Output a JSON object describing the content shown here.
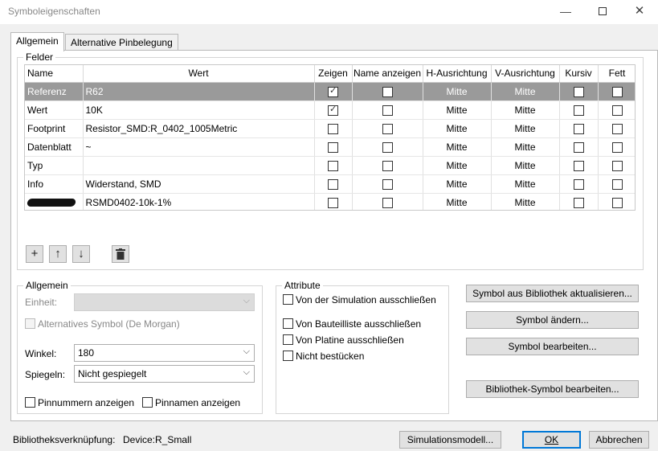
{
  "window": {
    "title": "Symboleigenschaften",
    "minimize_icon": "—",
    "close_icon": "✕"
  },
  "tabs": [
    {
      "label": "Allgemein"
    },
    {
      "label": "Alternative Pinbelegung"
    }
  ],
  "fields_group": {
    "label": "Felder",
    "columns": [
      "Name",
      "Wert",
      "Zeigen",
      "Name anzeigen",
      "H-Ausrichtung",
      "V-Ausrichtung",
      "Kursiv",
      "Fett"
    ],
    "rows": [
      {
        "name": "Referenz",
        "value": "R62",
        "show": true,
        "show_name": false,
        "h_align": "Mitte",
        "v_align": "Mitte",
        "italic": false,
        "bold": false,
        "selected": true
      },
      {
        "name": "Wert",
        "value": "10K",
        "show": true,
        "show_name": false,
        "h_align": "Mitte",
        "v_align": "Mitte",
        "italic": false,
        "bold": false
      },
      {
        "name": "Footprint",
        "value": "Resistor_SMD:R_0402_1005Metric",
        "show": false,
        "show_name": false,
        "h_align": "Mitte",
        "v_align": "Mitte",
        "italic": false,
        "bold": false
      },
      {
        "name": "Datenblatt",
        "value": "~",
        "show": false,
        "show_name": false,
        "h_align": "Mitte",
        "v_align": "Mitte",
        "italic": false,
        "bold": false
      },
      {
        "name": "Typ",
        "value": "",
        "show": false,
        "show_name": false,
        "h_align": "Mitte",
        "v_align": "Mitte",
        "italic": false,
        "bold": false
      },
      {
        "name": "Info",
        "value": "Widerstand, SMD",
        "show": false,
        "show_name": false,
        "h_align": "Mitte",
        "v_align": "Mitte",
        "italic": false,
        "bold": false
      },
      {
        "name": "",
        "value": "RSMD0402-10k-1%",
        "show": false,
        "show_name": false,
        "h_align": "Mitte",
        "v_align": "Mitte",
        "italic": false,
        "bold": false,
        "name_redacted": true
      }
    ],
    "toolbar_icons": [
      "add-icon",
      "arrow-up-icon",
      "arrow-down-icon",
      "trash-icon"
    ]
  },
  "general_group": {
    "label": "Allgemein",
    "unit_label": "Einheit:",
    "unit_value": "",
    "alt_symbol_label": "Alternatives Symbol (De Morgan)",
    "angle_label": "Winkel:",
    "angle_value": "180",
    "mirror_label": "Spiegeln:",
    "mirror_value": "Nicht gespiegelt",
    "show_pin_numbers_label": "Pinnummern anzeigen",
    "show_pin_names_label": "Pinnamen anzeigen"
  },
  "attributes_group": {
    "label": "Attribute",
    "exclude_sim_label": "Von der Simulation ausschließen",
    "exclude_bom_label": "Von Bauteilliste ausschließen",
    "exclude_board_label": "Von Platine ausschließen",
    "dnp_label": "Nicht bestücken"
  },
  "action_buttons": {
    "update_from_lib": "Symbol aus Bibliothek aktualisieren...",
    "change_symbol": "Symbol ändern...",
    "edit_symbol": "Symbol bearbeiten...",
    "edit_lib_symbol": "Bibliothek-Symbol bearbeiten..."
  },
  "footer": {
    "lib_link_label": "Bibliotheksverknüpfung:",
    "lib_link_value": "Device:R_Small",
    "sim_model_button": "Simulationsmodell...",
    "ok_button": "OK",
    "cancel_button": "Abbrechen"
  },
  "colors": {
    "selected_row": "#9a9a9a",
    "default_button_border": "#0078d7"
  }
}
